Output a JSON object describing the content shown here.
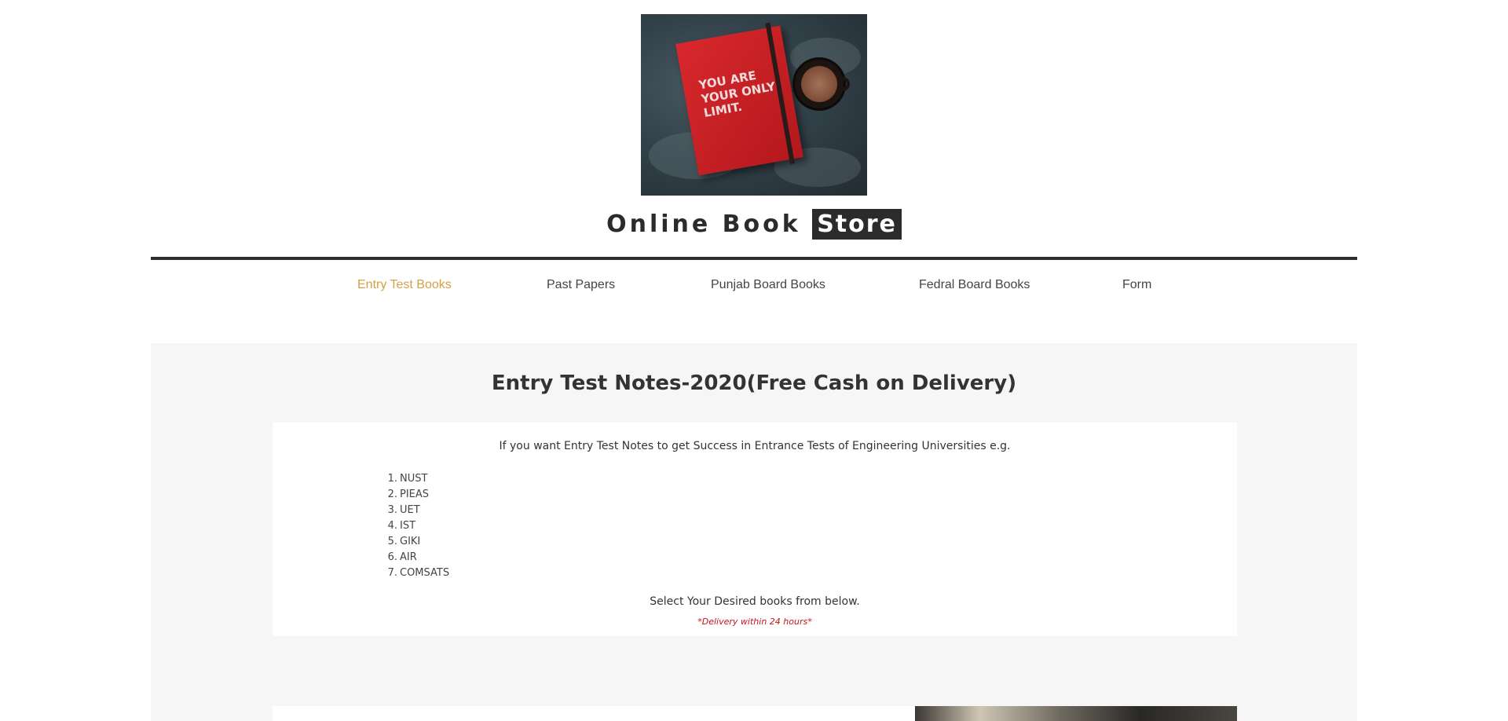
{
  "logo": {
    "cover_text": "YOU ARE\nYOUR ONLY\nLIMIT."
  },
  "header": {
    "title_main": "Online Book",
    "title_highlight": "Store"
  },
  "nav": {
    "items": [
      {
        "label": "Entry Test Books",
        "active": true
      },
      {
        "label": "Past Papers",
        "active": false
      },
      {
        "label": "Punjab Board Books",
        "active": false
      },
      {
        "label": "Fedral Board Books",
        "active": false
      },
      {
        "label": "Form",
        "active": false
      }
    ],
    "active_color": "#d6a047"
  },
  "main": {
    "heading": "Entry Test Notes-2020(Free Cash on Delivery)",
    "intro": "If you want Entry Test Notes to get Success in Entrance Tests of Engineering Universities e.g.",
    "universities": [
      "NUST",
      "PIEAS",
      "UET",
      "IST",
      "GIKI",
      "AIR",
      "COMSATS"
    ],
    "select_text": "Select Your Desired books from below.",
    "delivery_note": "*Delivery within 24 hours*",
    "delivery_color": "#c8121b"
  }
}
